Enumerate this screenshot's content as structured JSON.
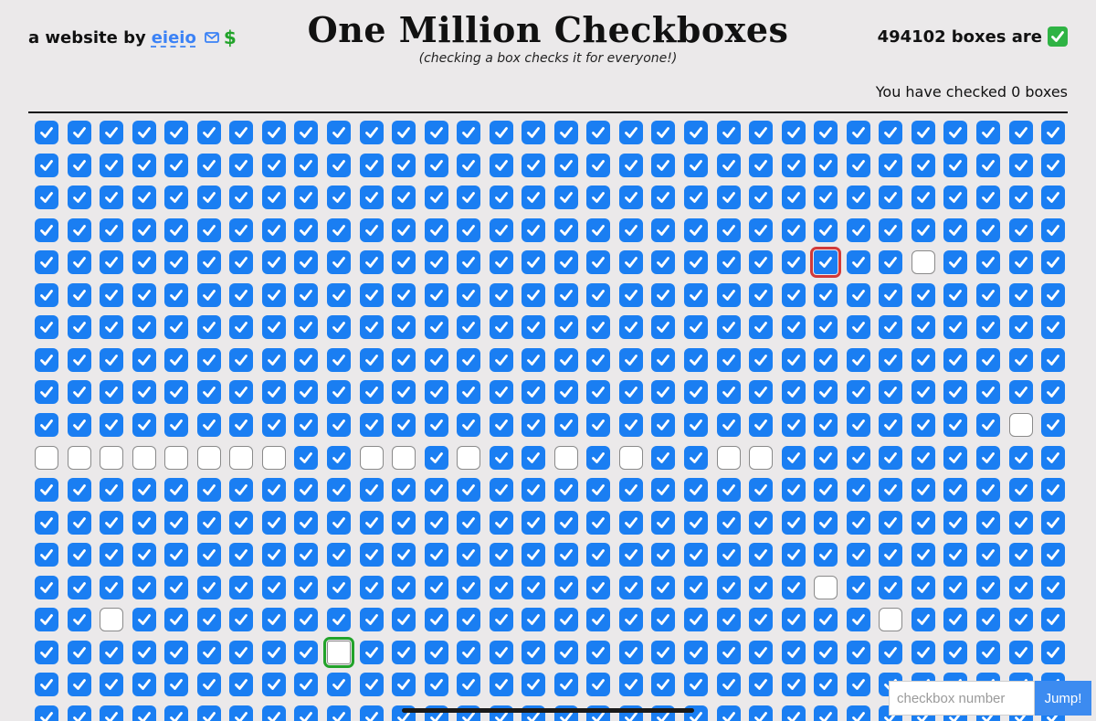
{
  "header": {
    "by_text": "a website by",
    "author_link": "eieio",
    "dollar_symbol": "$",
    "title": "One Million Checkboxes",
    "subtitle": "(checking a box checks it for everyone!)",
    "checked_count": "494102",
    "checked_suffix": "boxes are",
    "check_emoji_icon": "green-check-icon"
  },
  "user_status": {
    "text": "You have checked 0 boxes"
  },
  "grid": {
    "columns": 32,
    "rows": 19,
    "checked_color": "#1a7ef2",
    "unchecked_color": "#ffffff",
    "unchecked": [
      [
        4,
        27
      ],
      [
        9,
        30
      ],
      [
        10,
        0
      ],
      [
        10,
        1
      ],
      [
        10,
        2
      ],
      [
        10,
        3
      ],
      [
        10,
        4
      ],
      [
        10,
        5
      ],
      [
        10,
        6
      ],
      [
        10,
        7
      ],
      [
        10,
        10
      ],
      [
        10,
        11
      ],
      [
        10,
        13
      ],
      [
        10,
        16
      ],
      [
        10,
        18
      ],
      [
        10,
        21
      ],
      [
        10,
        22
      ],
      [
        14,
        24
      ],
      [
        15,
        2
      ],
      [
        15,
        26
      ],
      [
        16,
        9
      ]
    ],
    "highlight_red": [
      4,
      24
    ],
    "highlight_green": [
      16,
      9
    ]
  },
  "jump": {
    "placeholder": "checkbox number",
    "button_label": "Jump!"
  }
}
